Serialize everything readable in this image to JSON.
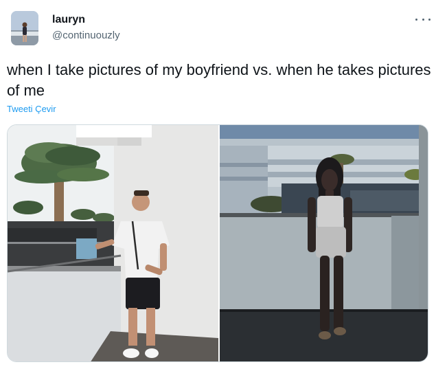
{
  "author": {
    "name": "lauryn",
    "handle": "@continuouzly"
  },
  "tweet": {
    "text": "when I take pictures of my boyfriend vs. when he takes pictures of me",
    "translate_label": "Tweeti Çevir"
  },
  "menu": {
    "icon": "more-horizontal-icon"
  },
  "media": {
    "photos": [
      {
        "subject": "boyfriend"
      },
      {
        "subject": "girlfriend"
      }
    ]
  }
}
